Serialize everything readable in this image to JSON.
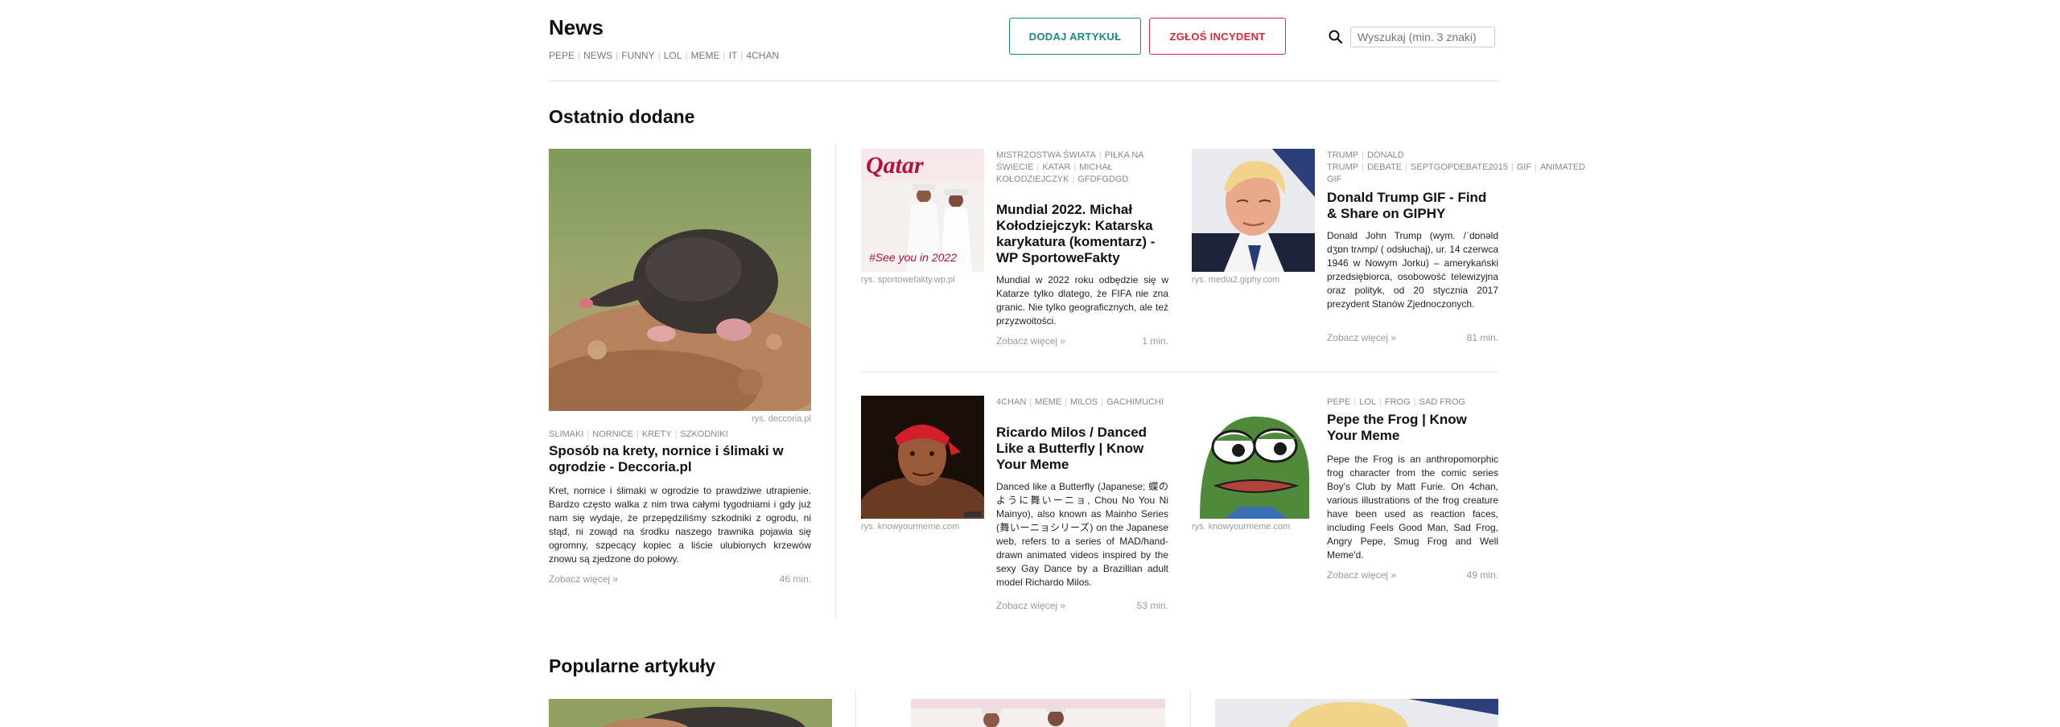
{
  "header": {
    "logo": "News",
    "categories": [
      "PEPE",
      "NEWS",
      "FUNNY",
      "LOL",
      "MEME",
      "IT",
      "4CHAN"
    ],
    "add_article": "DODAJ ARTYKUŁ",
    "report_incident": "ZGŁOŚ INCYDENT",
    "search_placeholder": "Wyszukaj (min. 3 znaki)",
    "search_value": ""
  },
  "recent": {
    "title": "Ostatnio dodane",
    "featured": {
      "source": "rys. deccoria.pl",
      "tags": [
        "SLIMAKI",
        "NORNICE",
        "KRETY",
        "SZKODNIKI"
      ],
      "title": "Sposób na krety, nornice i ślimaki w ogrodzie - Deccoria.pl",
      "description": "Kret, nornice i ślimaki w ogrodzie to prawdziwe utrapienie. Bardzo często walka z nim trwa całymi tygodniami i gdy już nam się wydaje, że przepędziliśmy szkodniki z ogrodu, ni stąd, ni zowąd na środku naszego trawnika pojawia się ogromny, szpecący kopiec a liście ulubionych krzewów znowu są zjedzone do połowy.",
      "more": "Zobacz więcej »",
      "time": "46 min."
    },
    "articles": [
      {
        "source": "rys. sportowefakty.wp.pl",
        "tags": [
          "MISTRZOSTWA ŚWIATA",
          "PIŁKA NA ŚWIECIE",
          "KATAR",
          "MICHAŁ KOŁODZIEJCZYK",
          "GFDFGDGD"
        ],
        "title": "Mundial 2022. Michał Kołodziejczyk: Katarska karykatura (komentarz) - WP SportoweFakty",
        "description": "Mundial w 2022 roku odbędzie się w Katarze tylko dlatego, że FIFA nie zna granic. Nie tylko geograficznych, ale też przyzwoitości.",
        "more": "Zobacz więcej »",
        "time": "1 min."
      },
      {
        "source": "rys. media2.giphy.com",
        "tags": [
          "TRUMP",
          "DONALD TRUMP",
          "DEBATE",
          "SEPTGOPDEBATE2015",
          "GIF",
          "ANIMATED GIF"
        ],
        "title": "Donald Trump GIF - Find & Share on GIPHY",
        "description": "Donald John Trump (wym. /ˈdɒnəld dʒɒn trʌmp/ ( odsłuchaj), ur. 14 czerwca 1946 w Nowym Jorku) – amerykański przedsiębiorca, osobowość telewizyjna oraz polityk, od 20 stycznia 2017 prezydent Stanów Zjednoczonych.",
        "more": "Zobacz więcej »",
        "time": "81 min."
      },
      {
        "source": "rys. knowyourmeme.com",
        "tags": [
          "4CHAN",
          "MEME",
          "MILOS",
          "GACHIMUCHI"
        ],
        "title": "Ricardo Milos / Danced Like a Butterfly | Know Your Meme",
        "description": "Danced like a Butterfly (Japanese; 蝶のように舞いーニョ, Chou No You Ni Mainyo), also known as Mainho Series (舞いーニョシリーズ) on the Japanese web, refers to a series of MAD/hand-drawn animated videos inspired by the sexy Gay Dance by a Brazillian adult model Richardo Milos.",
        "more": "Zobacz więcej »",
        "time": "53 min."
      },
      {
        "source": "rys. knowyourmeme.com",
        "tags": [
          "PEPE",
          "LOL",
          "FROG",
          "SAD FROG"
        ],
        "title": "Pepe the Frog | Know Your Meme",
        "description": "Pepe the Frog is an anthropomorphic frog character from the comic series Boy's Club by Matt Furie. On 4chan, various illustrations of the frog creature have been used as reaction faces, including Feels Good Man, Sad Frog, Angry Pepe, Smug Frog and Well Meme'd.",
        "more": "Zobacz więcej »",
        "time": "49 min."
      }
    ]
  },
  "popular": {
    "title": "Popularne artykuły"
  },
  "colors": {
    "add_button": "#1a8c7c",
    "report_button": "#d6293e"
  }
}
